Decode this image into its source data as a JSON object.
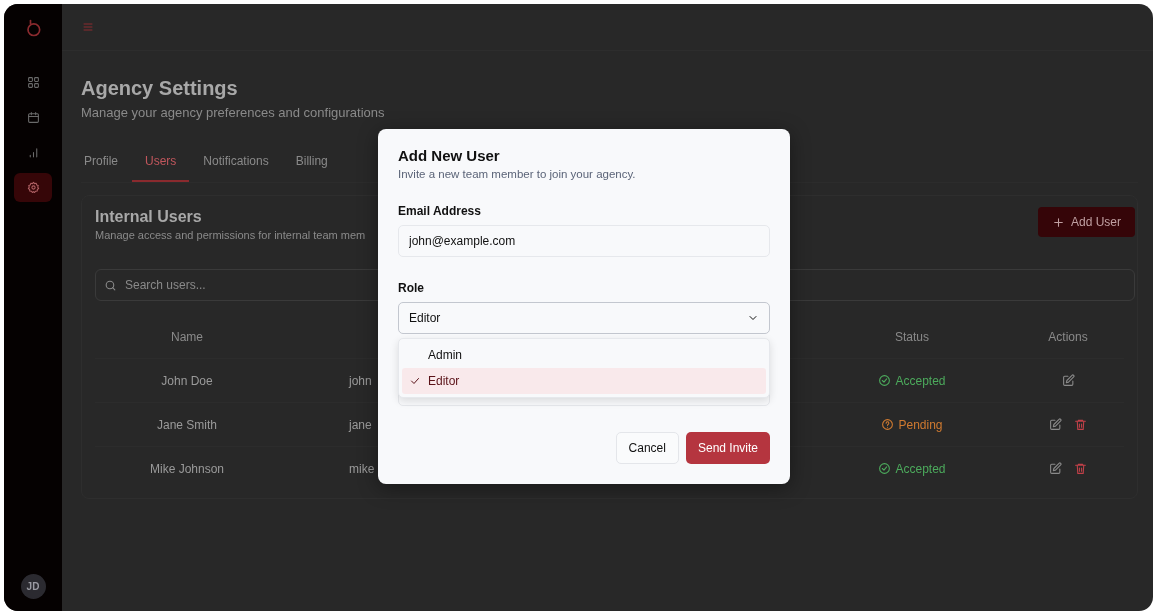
{
  "sidebar": {
    "nav_items": [
      {
        "selected": false
      },
      {
        "selected": false
      },
      {
        "selected": false
      },
      {
        "selected": true
      }
    ],
    "avatar": "JD"
  },
  "page": {
    "title": "Agency Settings",
    "subtitle": "Manage your agency preferences and configurations"
  },
  "tabs": [
    {
      "label": "Profile",
      "selected": false
    },
    {
      "label": "Users",
      "selected": true
    },
    {
      "label": "Notifications",
      "selected": false
    },
    {
      "label": "Billing",
      "selected": false
    }
  ],
  "card": {
    "title": "Internal Users",
    "subtitle": "Manage access and permissions for internal team mem",
    "add_button": "Add User",
    "search": {
      "placeholder": "Search users..."
    }
  },
  "table": {
    "columns": [
      "Name",
      "Status",
      "Actions"
    ],
    "rows": [
      {
        "name": "John Doe",
        "column_2": "john",
        "status": {
          "kind": "accepted",
          "label": "Accepted"
        },
        "can_delete": false
      },
      {
        "name": "Jane Smith",
        "column_2": "jane",
        "status": {
          "kind": "pending",
          "label": "Pending"
        },
        "can_delete": true
      },
      {
        "name": "Mike Johnson",
        "column_2": "mike",
        "status": {
          "kind": "accepted",
          "label": "Accepted"
        },
        "can_delete": true
      }
    ]
  },
  "modal": {
    "title": "Add New User",
    "subtitle": "Invite a new team member to join your agency.",
    "email": {
      "label": "Email Address",
      "value": "john@example.com"
    },
    "role": {
      "label": "Role",
      "value": "Editor",
      "expanded": true,
      "options": [
        {
          "label": "Admin",
          "selected": false
        },
        {
          "label": "Editor",
          "selected": true
        }
      ]
    },
    "buttons": [
      {
        "kind": "secondary",
        "label": "Cancel"
      },
      {
        "kind": "primary",
        "label": "Send Invite"
      }
    ]
  }
}
